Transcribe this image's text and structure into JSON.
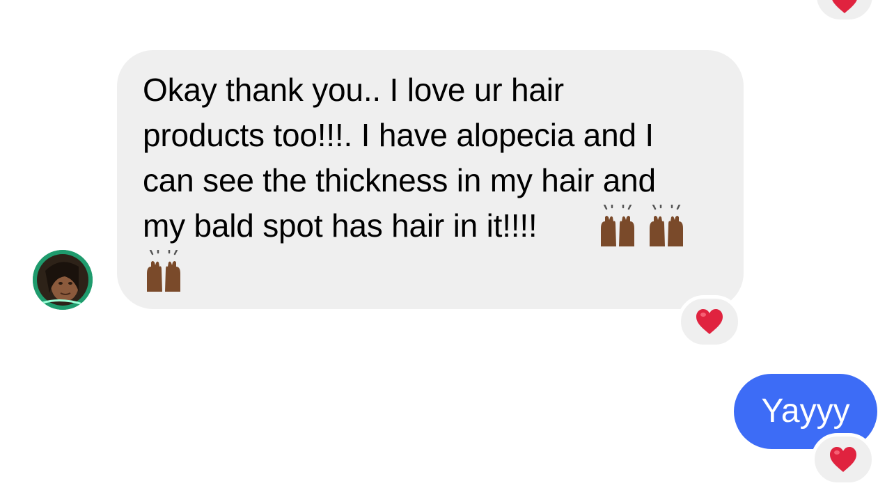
{
  "conversation": {
    "messages": [
      {
        "direction": "incoming",
        "text": "Okay thank you.. I love ur hair\nproducts too!!!. I have alopecia and I\ncan see the thickness in my hair and\nmy bald spot has hair in it!!!!",
        "emojis": [
          "raising-hands-medium-dark",
          "raising-hands-medium-dark",
          "raising-hands-medium-dark"
        ],
        "reaction": "heart"
      },
      {
        "direction": "outgoing",
        "text": "Yayyy",
        "reaction": "heart"
      }
    ],
    "top_partial_reaction": "heart",
    "avatar_icon": "contact-avatar-icon"
  },
  "colors": {
    "incoming_bubble": "#efefef",
    "outgoing_bubble": "#3d6cf6",
    "heart": "#e0233f",
    "reaction_pill": "#efefef"
  }
}
